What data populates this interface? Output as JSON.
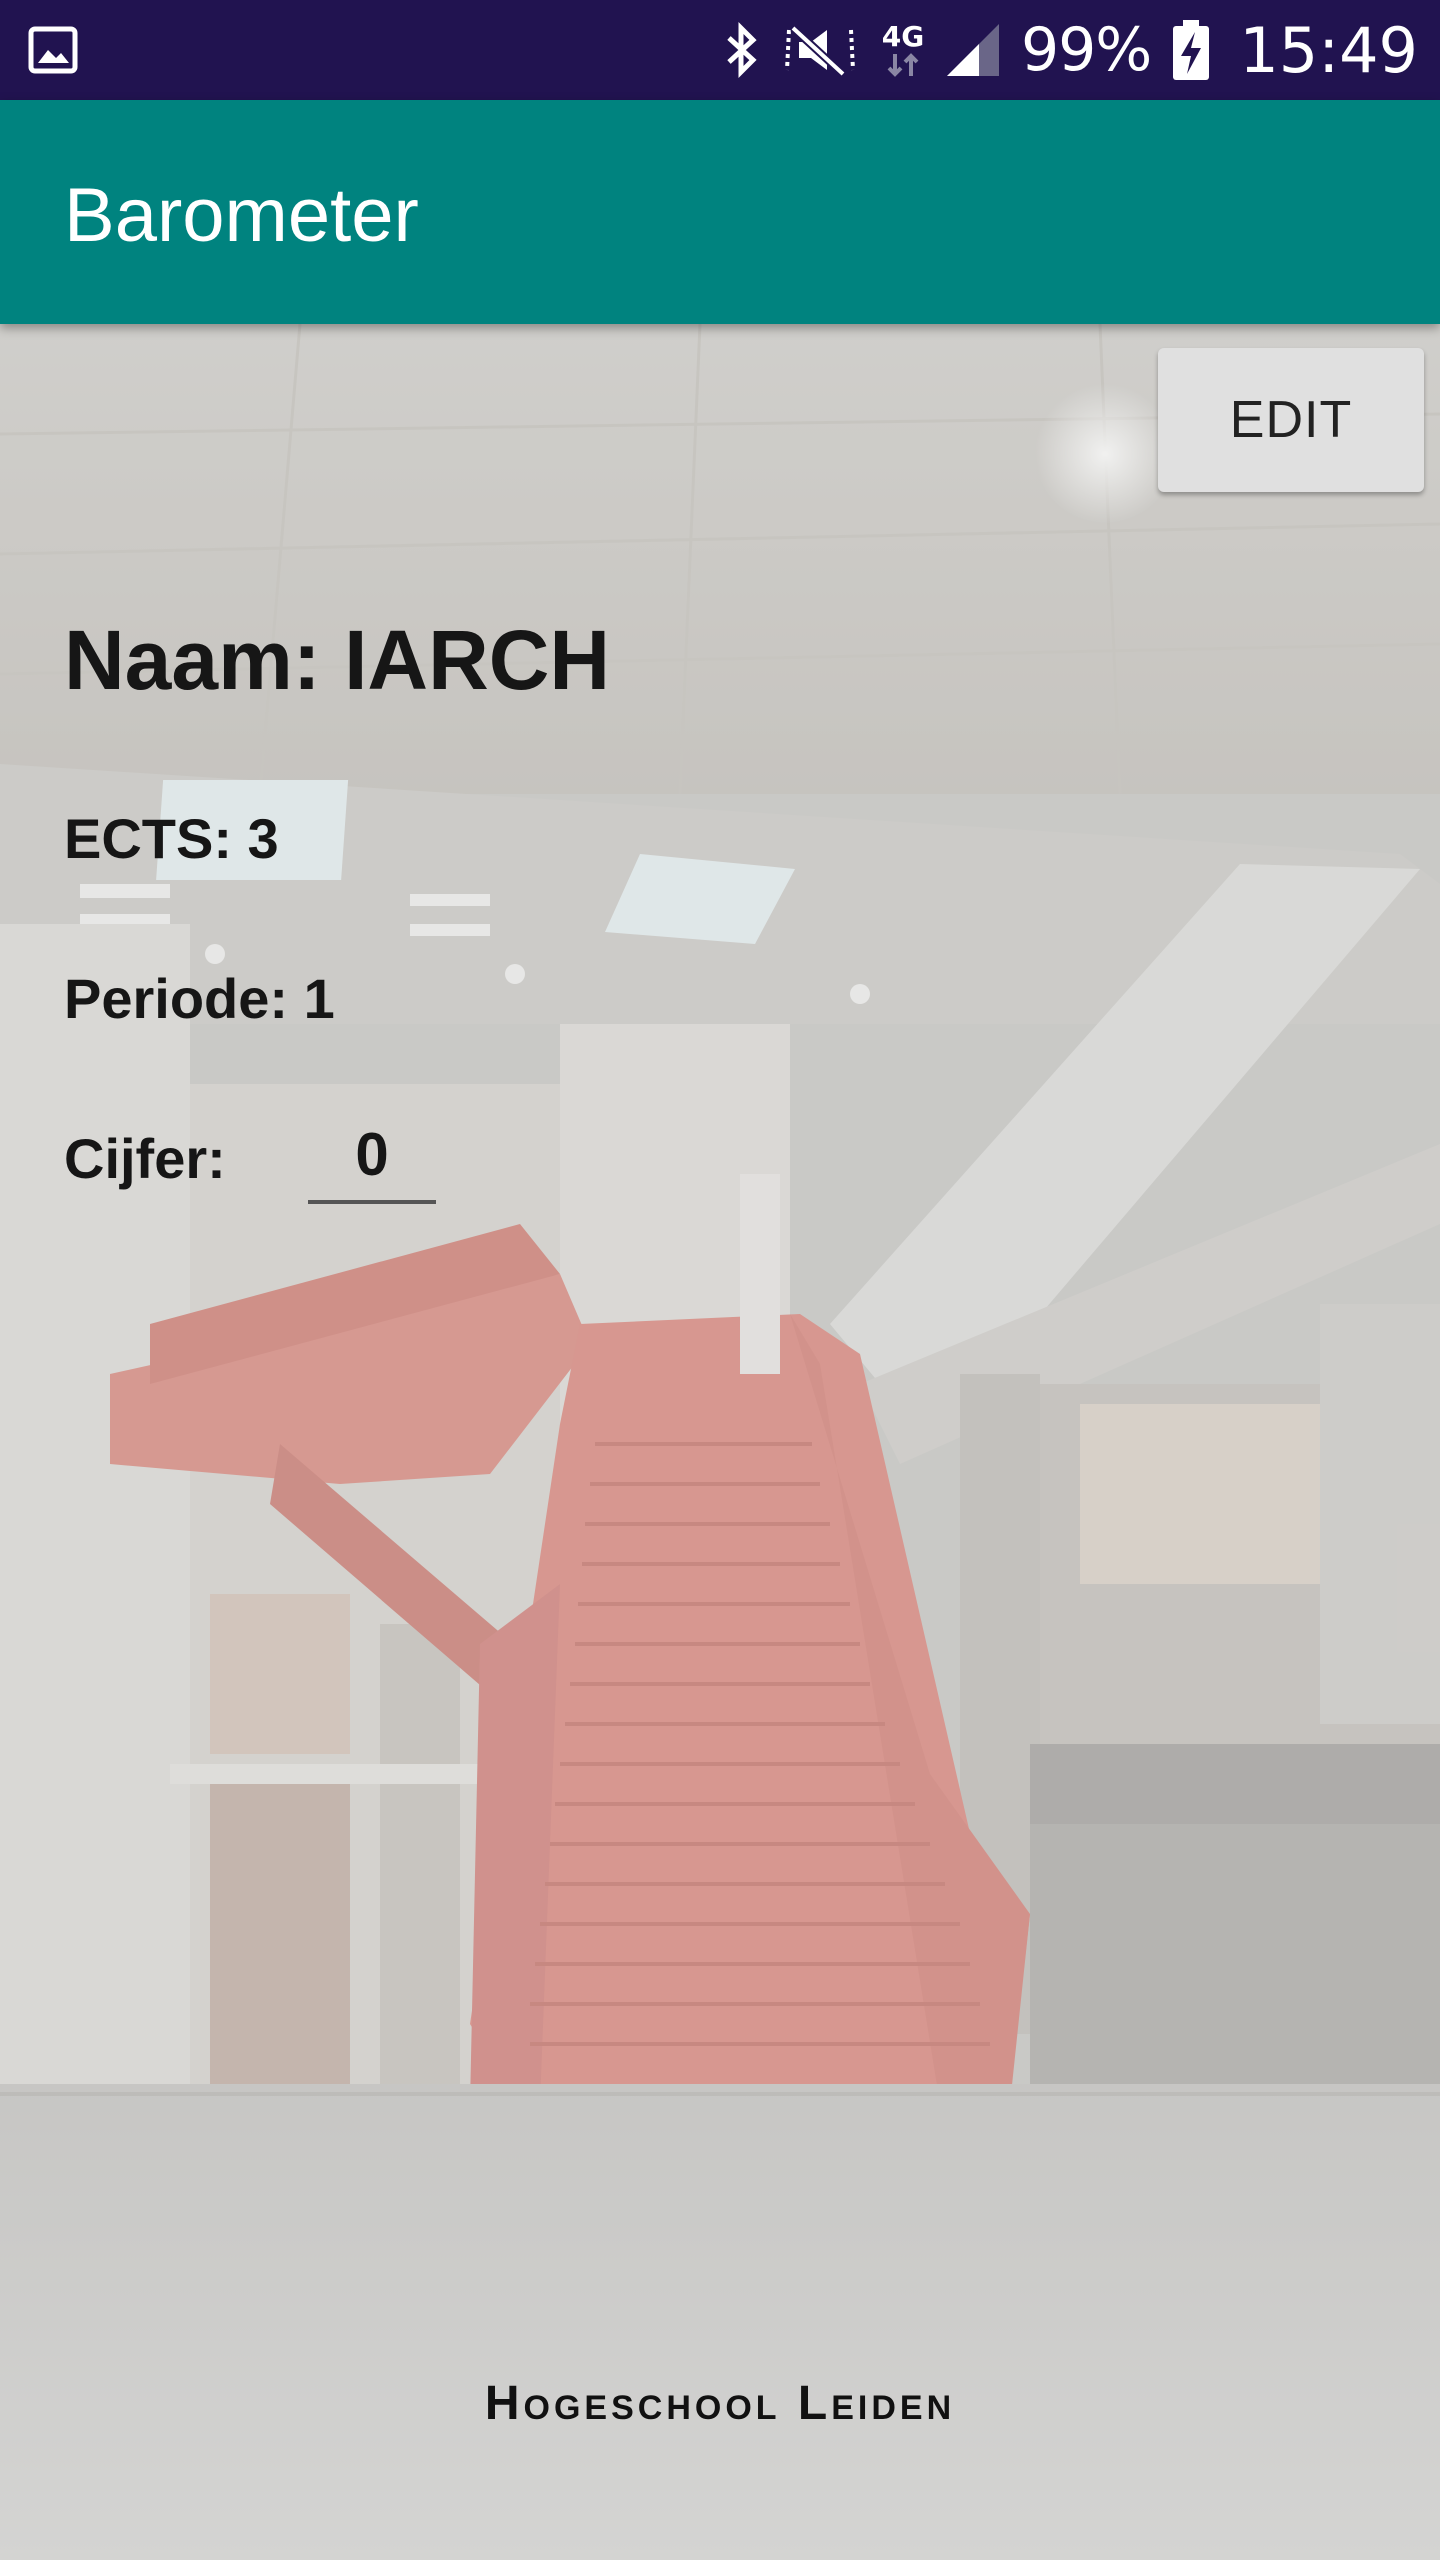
{
  "status_bar": {
    "notification_icon": "image-icon",
    "battery_percent": "99%",
    "time": "15:49",
    "network_label": "4G",
    "icons": [
      "bluetooth-icon",
      "muted-icon",
      "network-4g-icon",
      "signal-icon",
      "battery-charging-icon"
    ]
  },
  "app_bar": {
    "title": "Barometer"
  },
  "actions": {
    "edit_label": "EDIT"
  },
  "course": {
    "naam": "Naam: IARCH",
    "ects": "ECTS: 3",
    "periode": "Periode: 1",
    "cijfer_label": "Cijfer:",
    "cijfer_value": "0"
  },
  "footer": {
    "logo_text": "Hogeschool Leiden"
  },
  "colors": {
    "status_bar": "#211350",
    "app_bar": "#00837f",
    "stairs": "#d46a5f"
  }
}
